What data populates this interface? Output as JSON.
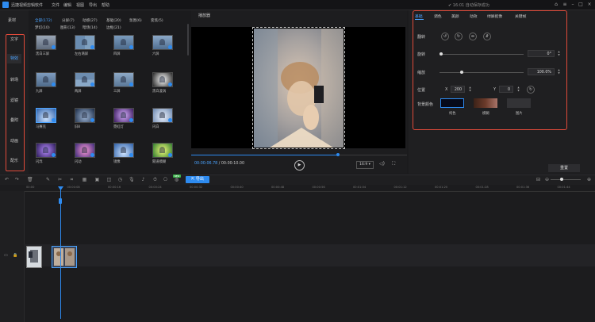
{
  "app": {
    "title": "迅捷视频剪辑软件",
    "menu": [
      "文件",
      "编辑",
      "视图",
      "导出",
      "帮助"
    ],
    "autosave": "16:01 自动保存成功",
    "window_buttons": [
      "home-icon",
      "menu-icon",
      "minimize-icon",
      "maximize-icon",
      "close-icon"
    ]
  },
  "sidebar": {
    "material_label": "素材",
    "categories": [
      {
        "label": "文字",
        "active": false
      },
      {
        "label": "特效",
        "active": true
      },
      {
        "label": "转场",
        "active": false
      },
      {
        "label": "滤镜",
        "active": false
      },
      {
        "label": "叠附",
        "active": false
      },
      {
        "label": "动画",
        "active": false
      },
      {
        "label": "配乐",
        "active": false
      }
    ]
  },
  "effects": {
    "filter_tabs": [
      {
        "label": "全部(172)",
        "active": true
      },
      {
        "label": "分屏(7)"
      },
      {
        "label": "动感(27)"
      },
      {
        "label": "基础(20)"
      },
      {
        "label": "氛围(6)"
      },
      {
        "label": "变焦(5)"
      },
      {
        "label": "梦幻(10)"
      },
      {
        "label": "图形(13)"
      },
      {
        "label": "暗场(14)"
      },
      {
        "label": "边框(21)"
      }
    ],
    "items": [
      {
        "label": "黑白三屏",
        "style": "triple-bw"
      },
      {
        "label": "左右两屏",
        "style": "two-lr"
      },
      {
        "label": "四屏",
        "style": "four"
      },
      {
        "label": "六屏",
        "style": "six"
      },
      {
        "label": "九屏",
        "style": "nine"
      },
      {
        "label": "两屏",
        "style": "two-tb"
      },
      {
        "label": "三屏",
        "style": "three"
      },
      {
        "label": "黑白漩涡",
        "style": "swirl"
      },
      {
        "label": "马赛克",
        "style": "tree-blue"
      },
      {
        "label": "旧8",
        "style": "tree-dark"
      },
      {
        "label": "霓虹灯",
        "style": "neon"
      },
      {
        "label": "闪白",
        "style": "tree-light"
      },
      {
        "label": "闪烁",
        "style": "tree-purple"
      },
      {
        "label": "闪动",
        "style": "tree-pink"
      },
      {
        "label": "镜像",
        "style": "tree-blue"
      },
      {
        "label": "隧道模糊",
        "style": "tree-green"
      }
    ]
  },
  "preview": {
    "title": "播放器",
    "time_current": "00:00:06.78",
    "time_total": "/ 00:00:10.00",
    "progress": 0.68,
    "ratio": "16:9"
  },
  "properties": {
    "tabs": [
      {
        "label": "基础",
        "active": true
      },
      {
        "label": "调色"
      },
      {
        "label": "美颜"
      },
      {
        "label": "动效"
      },
      {
        "label": "绿屏抠像"
      },
      {
        "label": "关键帧"
      }
    ],
    "flip_label": "翻转",
    "rotate_label": "旋转",
    "rotate_value": "0°",
    "rotate_level": 0.0,
    "scale_label": "缩放",
    "scale_value": "100.0%",
    "scale_level": 0.25,
    "position_label": "位置",
    "pos_x_label": "X",
    "pos_x": "200",
    "pos_y_label": "Y",
    "pos_y": "0",
    "bg_label": "背景颜色",
    "swatches": [
      {
        "label": "纯色",
        "color": "#060a1a",
        "selected": true
      },
      {
        "label": "模糊",
        "color": "#6b3a2a"
      },
      {
        "label": "图片",
        "color": "#333336"
      }
    ],
    "reset_label": "重置"
  },
  "toolbar": {
    "export_label": "导出",
    "new_badge": "NEW"
  },
  "timeline": {
    "ticks": [
      "00:00",
      "00:00:08",
      "00:00:16",
      "00:00:24",
      "00:00:32",
      "00:00:40",
      "00:00:48",
      "00:00:56",
      "00:01:04",
      "00:01:12",
      "00:01:20",
      "00:01:28",
      "00:01:36",
      "00:01:44"
    ]
  },
  "colors": {
    "accent": "#2e8bf0",
    "highlight": "#e04a3a"
  }
}
